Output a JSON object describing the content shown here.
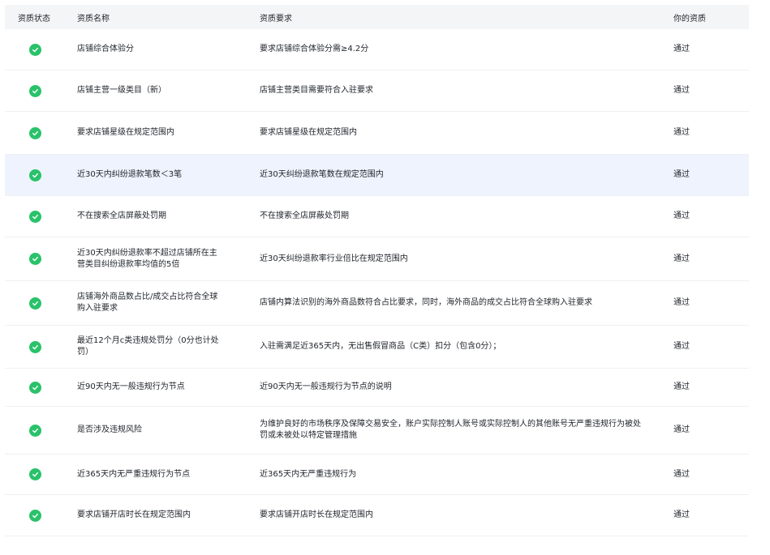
{
  "colors": {
    "pass_icon": "#29c26a",
    "header_bg": "#f4f5f7",
    "highlight_row_bg": "#eef3fd"
  },
  "header": {
    "status": "资质状态",
    "name": "资质名称",
    "requirement": "资质要求",
    "yours": "你的资质"
  },
  "rows": [
    {
      "status_icon": "check-circle-icon",
      "name": "店铺综合体验分",
      "requirement": "要求店铺综合体验分需≥4.2分",
      "yours": "通过"
    },
    {
      "status_icon": "check-circle-icon",
      "name": "店铺主营一级类目（新）",
      "requirement": "店铺主营类目需要符合入驻要求",
      "yours": "通过"
    },
    {
      "status_icon": "check-circle-icon",
      "name": "要求店铺星级在规定范围内",
      "requirement": "要求店铺星级在规定范围内",
      "yours": "通过"
    },
    {
      "status_icon": "check-circle-icon",
      "name": "近30天内纠纷退款笔数＜3笔",
      "requirement": "近30天纠纷退款笔数在规定范围内",
      "yours": "通过",
      "highlighted": true
    },
    {
      "status_icon": "check-circle-icon",
      "name": "不在搜索全店屏蔽处罚期",
      "requirement": "不在搜索全店屏蔽处罚期",
      "yours": "通过"
    },
    {
      "status_icon": "check-circle-icon",
      "name": "近30天内纠纷退款率不超过店铺所在主营类目纠纷退款率均值的5倍",
      "requirement": "近30天纠纷退款率行业倍比在规定范围内",
      "yours": "通过"
    },
    {
      "status_icon": "check-circle-icon",
      "name": "店铺海外商品数占比/成交占比符合全球购入驻要求",
      "requirement": "店铺内算法识别的海外商品数符合占比要求，同时，海外商品的成交占比符合全球购入驻要求",
      "yours": "通过"
    },
    {
      "status_icon": "check-circle-icon",
      "name": "最近12个月c类违规处罚分（0分也计处罚）",
      "requirement": "入驻需满足近365天内，无出售假冒商品（C类）扣分（包含0分）；",
      "yours": "通过"
    },
    {
      "status_icon": "check-circle-icon",
      "name": "近90天内无一般违规行为节点",
      "requirement": "近90天内无一般违规行为节点的说明",
      "yours": "通过"
    },
    {
      "status_icon": "check-circle-icon",
      "name": "是否涉及违规风险",
      "requirement": "为维护良好的市场秩序及保障交易安全，账户实际控制人账号或实际控制人的其他账号无严重违规行为被处罚或未被处以特定管理措施",
      "yours": "通过"
    },
    {
      "status_icon": "check-circle-icon",
      "name": "近365天内无严重违规行为节点",
      "requirement": "近365天内无严重违规行为",
      "yours": "通过"
    },
    {
      "status_icon": "check-circle-icon",
      "name": "要求店铺开店时长在规定范围内",
      "requirement": "要求店铺开店时长在规定范围内",
      "yours": "通过"
    }
  ]
}
